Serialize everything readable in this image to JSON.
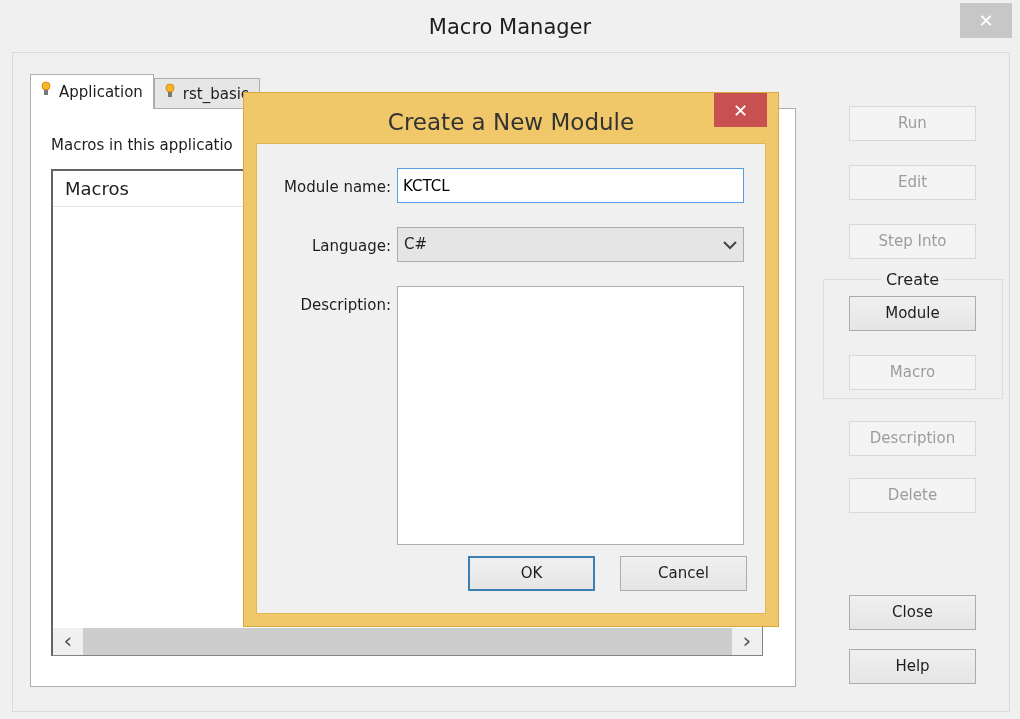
{
  "window": {
    "title": "Macro Manager",
    "close": "✕"
  },
  "tabs": [
    {
      "label": "Application",
      "selected": true
    },
    {
      "label": "rst_basic",
      "selected": false
    }
  ],
  "panel": {
    "caption": "Macros in this applicatio",
    "list_header": "Macros",
    "scroll_left": "‹",
    "scroll_right": "›"
  },
  "buttons": [
    {
      "label": "Run",
      "disabled": true,
      "group": false
    },
    {
      "label": "Edit",
      "disabled": true,
      "group": false
    },
    {
      "label": "Step Into",
      "disabled": true,
      "group": false
    },
    {
      "label": "Module",
      "disabled": false,
      "group": true
    },
    {
      "label": "Macro",
      "disabled": true,
      "group": true
    },
    {
      "label": "Description",
      "disabled": true,
      "group": false
    },
    {
      "label": "Delete",
      "disabled": true,
      "group": false
    }
  ],
  "create_group": {
    "label": "Create"
  },
  "bottom_buttons": [
    {
      "label": "Close",
      "disabled": false
    },
    {
      "label": "Help",
      "disabled": false
    }
  ],
  "dialog": {
    "title": "Create a New Module",
    "close": "✕",
    "fields": [
      {
        "kind": "text",
        "label": "Module name:",
        "value": "KCTCL",
        "focused": true
      },
      {
        "kind": "select",
        "label": "Language:",
        "value": "C#"
      },
      {
        "kind": "textarea",
        "label": "Description:"
      }
    ],
    "buttons": [
      {
        "label": "OK",
        "default": true
      },
      {
        "label": "Cancel",
        "default": false
      }
    ]
  }
}
